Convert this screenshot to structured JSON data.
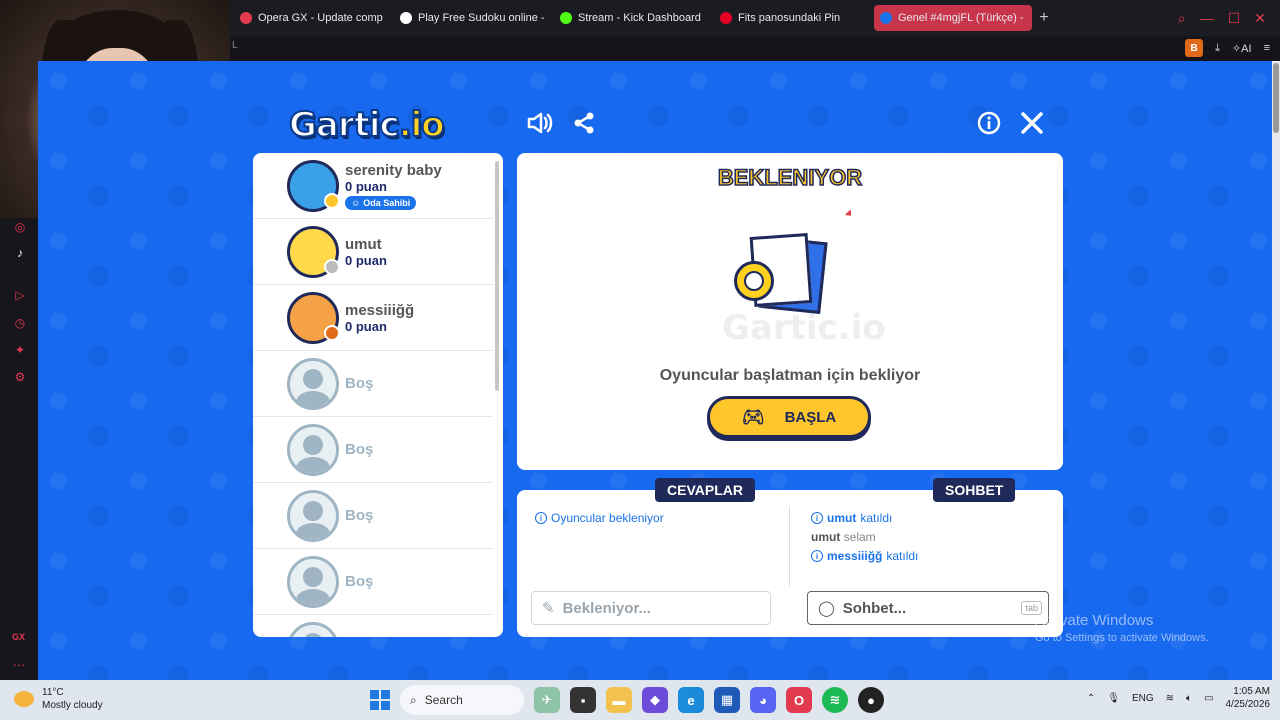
{
  "browser": {
    "tabs": [
      {
        "label": "Opera GX - Update comp",
        "icon": "opera-icon",
        "color": "#e23a4f",
        "active": false
      },
      {
        "label": "Play Free Sudoku online -",
        "icon": "sudoku-icon",
        "color": "#ffffff",
        "active": false
      },
      {
        "label": "Stream - Kick Dashboard",
        "icon": "kick-icon",
        "color": "#53fc18",
        "active": false
      },
      {
        "label": "Fits panosundaki Pin",
        "icon": "pinterest-icon",
        "color": "#e60023",
        "active": false
      },
      {
        "label": "Genel #4mgjFL (Türkçe) -",
        "icon": "gartic-icon",
        "color": "#1a73e8",
        "active": true
      }
    ],
    "new_tab": "+",
    "addr_left": "L",
    "profile_badge": "B",
    "ai_label": "AI"
  },
  "game": {
    "logo_main": "Gartic",
    "logo_suffix": ".io",
    "players": [
      {
        "name": "serenity baby",
        "score": "0 puan",
        "badge": "Oda Sahibi",
        "avatar_color": "#3aa0e8",
        "dot_color": "#ffc62b"
      },
      {
        "name": "umut",
        "score": "0 puan",
        "avatar_color": "#ffd94a",
        "dot_color": "#bbbbbb"
      },
      {
        "name": "messiiiğğ",
        "score": "0 puan",
        "avatar_color": "#f4a245",
        "dot_color": "#e06a1a"
      }
    ],
    "empty_slot_label": "Boş",
    "status_title": "BEKLENIYOR",
    "waiting_text": "Oyuncular başlatman için bekliyor",
    "start_button": "BAŞLA",
    "answers_tab": "CEVAPLAR",
    "chat_tab": "SOHBET",
    "answers_info": "Oyuncular bekleniyor",
    "chat_messages": [
      {
        "type": "info",
        "user": "umut",
        "text": "katıldı"
      },
      {
        "type": "msg",
        "user": "umut",
        "text": "selam"
      },
      {
        "type": "info",
        "user": "messiiiğğ",
        "text": "katıldı"
      }
    ],
    "answer_placeholder": "Bekleniyor...",
    "chat_placeholder": "Sohbet...",
    "tab_key": "tab"
  },
  "watermark": {
    "line1": "Activate Windows",
    "line2": "Go to Settings to activate Windows."
  },
  "taskbar": {
    "temp": "11°C",
    "weather": "Mostly cloudy",
    "search": "Search",
    "lang": "ENG",
    "time": "1:05 AM",
    "date": "4/25/2026"
  }
}
